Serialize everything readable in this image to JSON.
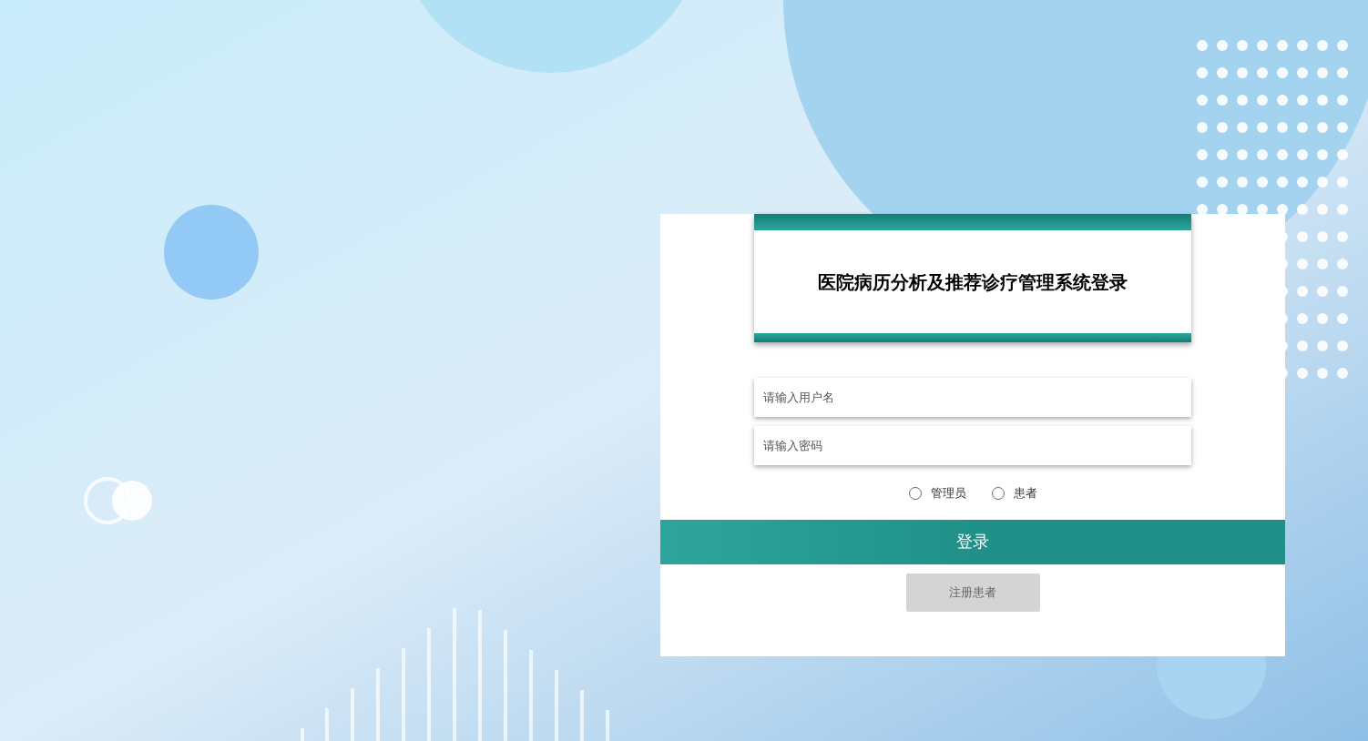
{
  "login_panel": {
    "title": "医院病历分析及推荐诊疗管理系统登录",
    "fields": [
      {
        "placeholder": "请输入用户名"
      },
      {
        "placeholder": "请输入密码"
      }
    ],
    "roles": [
      {
        "label": "管理员",
        "selected": false
      },
      {
        "label": "患者",
        "selected": false
      }
    ],
    "login_button": "登录",
    "register_button": "注册患者"
  }
}
